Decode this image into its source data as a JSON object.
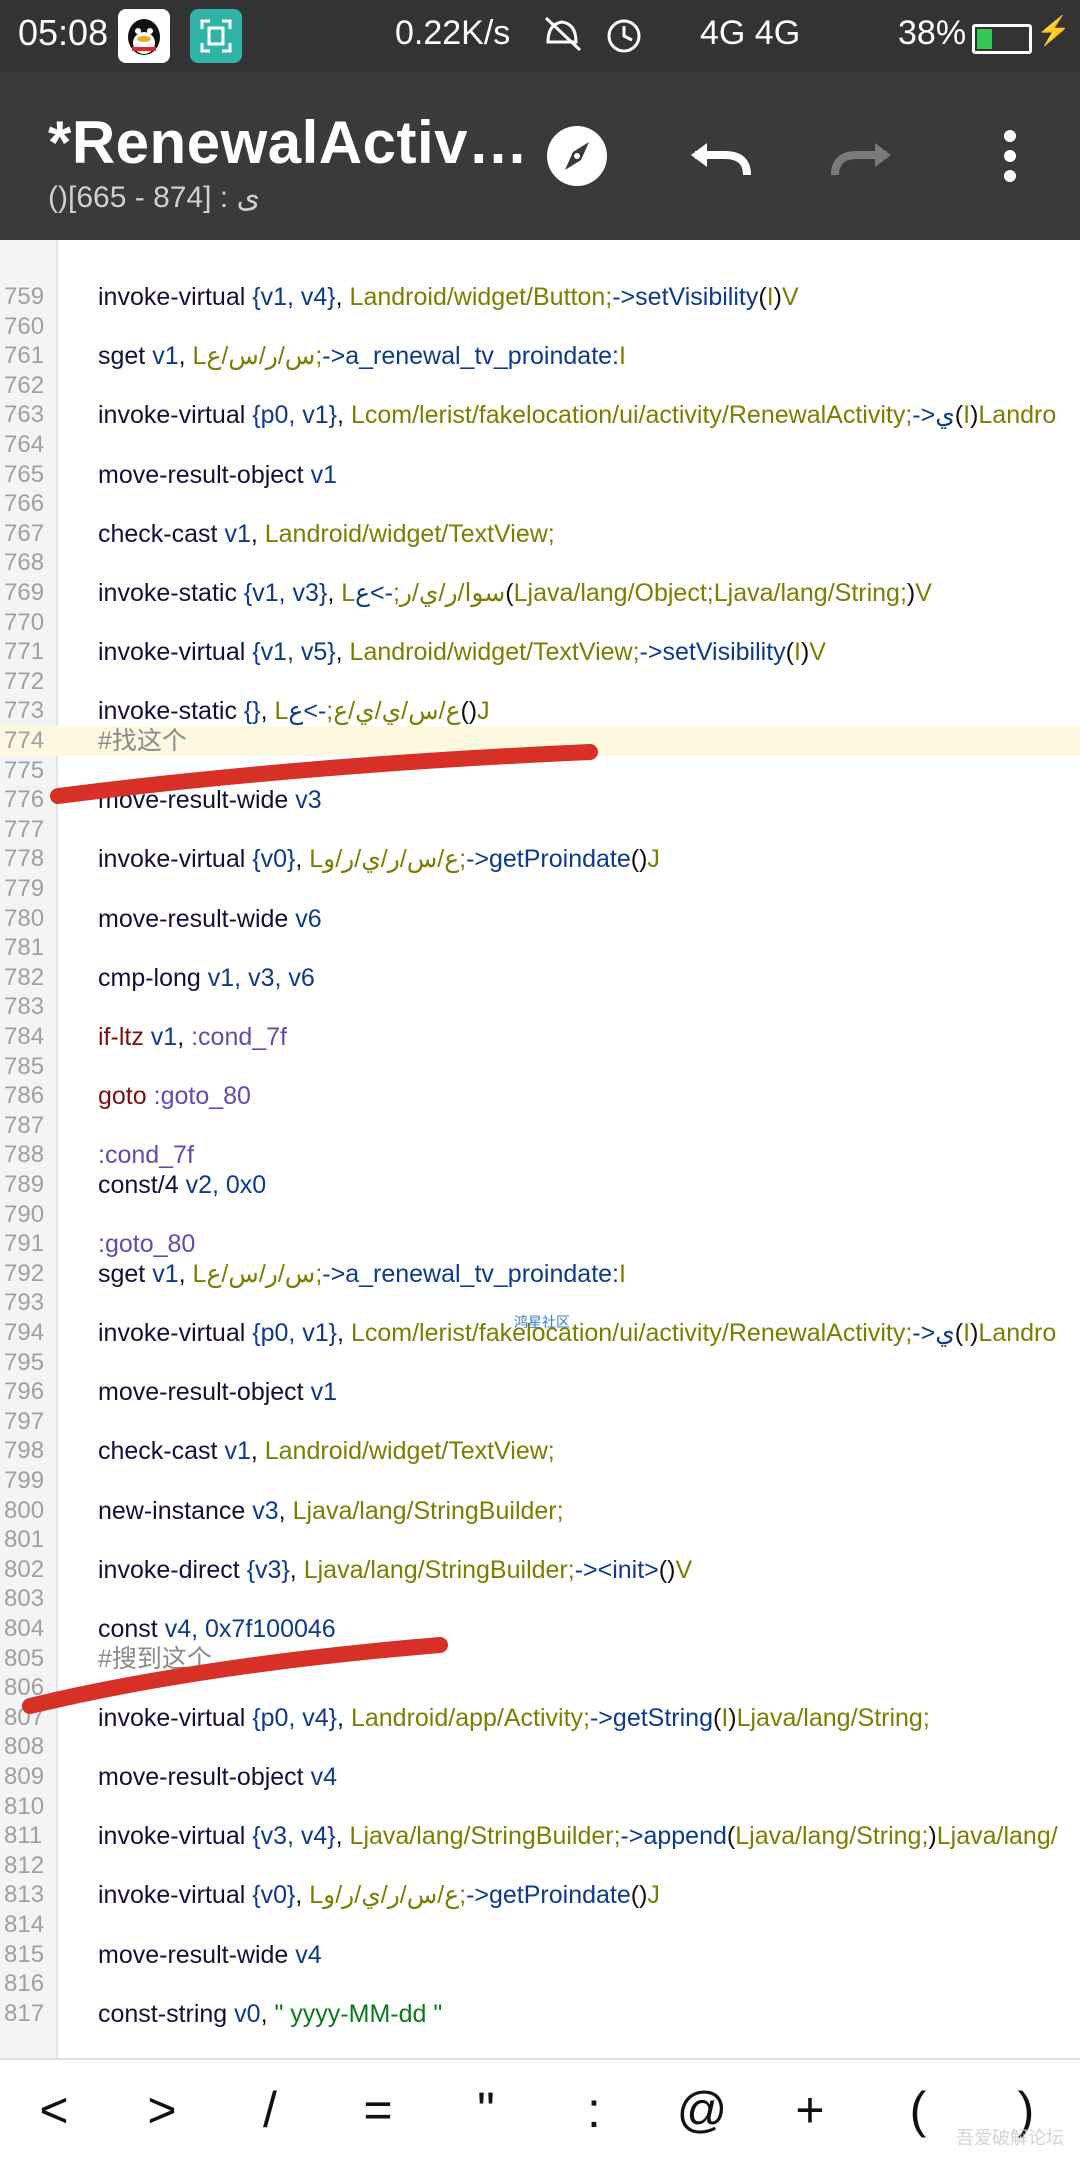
{
  "status_bar": {
    "time": "05:08",
    "speed": "0.22K/s",
    "network": "4G 4G",
    "battery": "38%",
    "battery_level_pct": 30
  },
  "toolbar": {
    "title": "*RenewalActiv…",
    "subtitle": "()ى : [874 - 665]"
  },
  "code": {
    "lines": [
      {
        "n": "759",
        "html": "<span class='kw'>invoke-virtual</span>  <span class='reg'>{v1,  v4}</span>,  <span class='type'>Landroid/widget/Button;</span><span class='meth'>-&gt;setVisibility</span>(<span class='type'>I</span>)<span class='type'>V</span>"
      },
      {
        "n": "760",
        "html": ""
      },
      {
        "n": "761",
        "html": "<span class='kw'>sget</span>  <span class='reg'>v1</span>,  <span class='type'>Lس/ر/س/ع;</span><span class='meth'>-&gt;a_renewal_tv_proindate:</span><span class='type'>I</span>"
      },
      {
        "n": "762",
        "html": ""
      },
      {
        "n": "763",
        "html": "<span class='kw'>invoke-virtual</span>  <span class='reg'>{p0,  v1}</span>,  <span class='type'>Lcom/lerist/fakelocation/ui/activity/RenewalActivity;</span><span class='meth'>-&gt;ي</span>(<span class='type'>I</span>)<span class='type'>Landro</span>"
      },
      {
        "n": "764",
        "html": ""
      },
      {
        "n": "765",
        "html": "<span class='kw'>move-result-object</span>  <span class='reg'>v1</span>"
      },
      {
        "n": "766",
        "html": ""
      },
      {
        "n": "767",
        "html": "<span class='kw'>check-cast</span>  <span class='reg'>v1</span>,  <span class='type'>Landroid/widget/TextView;</span>"
      },
      {
        "n": "768",
        "html": ""
      },
      {
        "n": "769",
        "html": "<span class='kw'>invoke-static</span>  <span class='reg'>{v1,  v3}</span>,  <span class='type'>Lسوا/ر/ي/ر;</span><span class='meth'>-&gt;ع</span>(<span class='type'>Ljava/lang/Object;Ljava/lang/String;</span>)<span class='type'>V</span>"
      },
      {
        "n": "770",
        "html": ""
      },
      {
        "n": "771",
        "html": "<span class='kw'>invoke-virtual</span>  <span class='reg'>{v1,  v5}</span>,  <span class='type'>Landroid/widget/TextView;</span><span class='meth'>-&gt;setVisibility</span>(<span class='type'>I</span>)<span class='type'>V</span>"
      },
      {
        "n": "772",
        "html": ""
      },
      {
        "n": "773",
        "html": "<span class='kw'>invoke-static</span>  <span class='reg'>{}</span>,  <span class='type'>Lع/س/ي/ي/ع;</span><span class='meth'>-&gt;ع</span>()<span class='type'>J</span>"
      },
      {
        "n": "774",
        "html": "<span class='cmt'>#找这个</span>",
        "hl": true
      },
      {
        "n": "775",
        "html": ""
      },
      {
        "n": "776",
        "html": "<span class='kw'>move-result-wide</span>  <span class='reg'>v3</span>"
      },
      {
        "n": "777",
        "html": ""
      },
      {
        "n": "778",
        "html": "<span class='kw'>invoke-virtual</span>  <span class='reg'>{v0}</span>,  <span class='type'>Lع/س/ر/ي/ر/و;</span><span class='meth'>-&gt;getProindate</span>()<span class='type'>J</span>"
      },
      {
        "n": "779",
        "html": ""
      },
      {
        "n": "780",
        "html": "<span class='kw'>move-result-wide</span>  <span class='reg'>v6</span>"
      },
      {
        "n": "781",
        "html": ""
      },
      {
        "n": "782",
        "html": "<span class='kw'>cmp-long</span>  <span class='reg'>v1,  v3,  v6</span>"
      },
      {
        "n": "783",
        "html": ""
      },
      {
        "n": "784",
        "html": "<span class='jmp'>if-ltz</span>  <span class='reg'>v1</span>,  <span class='label'>:cond_7f</span>"
      },
      {
        "n": "785",
        "html": ""
      },
      {
        "n": "786",
        "html": "<span class='jmp'>goto</span>  <span class='label'>:goto_80</span>"
      },
      {
        "n": "787",
        "html": ""
      },
      {
        "n": "788",
        "html": "<span class='label'>:cond_7f</span>"
      },
      {
        "n": "789",
        "html": "<span class='kw'>const/4</span>  <span class='reg'>v2,  0x0</span>"
      },
      {
        "n": "790",
        "html": ""
      },
      {
        "n": "791",
        "html": "<span class='label'>:goto_80</span>"
      },
      {
        "n": "792",
        "html": "<span class='kw'>sget</span>  <span class='reg'>v1</span>,  <span class='type'>Lس/ر/س/ع;</span><span class='meth'>-&gt;a_renewal_tv_proindate:</span><span class='type'>I</span>"
      },
      {
        "n": "793",
        "html": ""
      },
      {
        "n": "794",
        "html": "<span class='kw'>invoke-virtual</span>  <span class='reg'>{p0,  v1}</span>,  <span class='type'>Lcom/lerist/fakelocation/ui/activity/RenewalActivity;</span><span class='meth'>-&gt;ي</span>(<span class='type'>I</span>)<span class='type'>Landro</span>"
      },
      {
        "n": "795",
        "html": ""
      },
      {
        "n": "796",
        "html": "<span class='kw'>move-result-object</span>  <span class='reg'>v1</span>"
      },
      {
        "n": "797",
        "html": ""
      },
      {
        "n": "798",
        "html": "<span class='kw'>check-cast</span>  <span class='reg'>v1</span>,  <span class='type'>Landroid/widget/TextView;</span>"
      },
      {
        "n": "799",
        "html": ""
      },
      {
        "n": "800",
        "html": "<span class='kw'>new-instance</span>  <span class='reg'>v3</span>,  <span class='type'>Ljava/lang/StringBuilder;</span>"
      },
      {
        "n": "801",
        "html": ""
      },
      {
        "n": "802",
        "html": "<span class='kw'>invoke-direct</span>  <span class='reg'>{v3}</span>,  <span class='type'>Ljava/lang/StringBuilder;</span><span class='meth'>-&gt;&lt;init&gt;</span>()<span class='type'>V</span>"
      },
      {
        "n": "803",
        "html": ""
      },
      {
        "n": "804",
        "html": "<span class='kw'>const</span>  <span class='reg'>v4,  0x7f100046</span>"
      },
      {
        "n": "805",
        "html": "<span class='cmt'>#搜到这个</span>"
      },
      {
        "n": "806",
        "html": ""
      },
      {
        "n": "807",
        "html": "<span class='kw'>invoke-virtual</span>  <span class='reg'>{p0,  v4}</span>,  <span class='type'>Landroid/app/Activity;</span><span class='meth'>-&gt;getString</span>(<span class='type'>I</span>)<span class='type'>Ljava/lang/String;</span>"
      },
      {
        "n": "808",
        "html": ""
      },
      {
        "n": "809",
        "html": "<span class='kw'>move-result-object</span>  <span class='reg'>v4</span>"
      },
      {
        "n": "810",
        "html": ""
      },
      {
        "n": "811",
        "html": "<span class='kw'>invoke-virtual</span>  <span class='reg'>{v3,  v4}</span>,  <span class='type'>Ljava/lang/StringBuilder;</span><span class='meth'>-&gt;append</span>(<span class='type'>Ljava/lang/String;</span>)<span class='type'>Ljava/lang/</span>"
      },
      {
        "n": "812",
        "html": ""
      },
      {
        "n": "813",
        "html": "<span class='kw'>invoke-virtual</span>  <span class='reg'>{v0}</span>,  <span class='type'>Lع/س/ر/ي/ر/و;</span><span class='meth'>-&gt;getProindate</span>()<span class='type'>J</span>"
      },
      {
        "n": "814",
        "html": ""
      },
      {
        "n": "815",
        "html": "<span class='kw'>move-result-wide</span>  <span class='reg'>v4</span>"
      },
      {
        "n": "816",
        "html": ""
      },
      {
        "n": "817",
        "html": "<span class='kw'>const-string</span>  <span class='reg'>v0</span>,  <span class='str'>\"    yyyy-MM-dd  \"</span>"
      }
    ]
  },
  "watermark": "鸿星社区",
  "symbol_bar": [
    "<",
    ">",
    "/",
    "=",
    "\"",
    ":",
    "@",
    "+",
    "(",
    ")"
  ],
  "brand_mark": "吾爱破解论坛",
  "colors": {
    "toolbar_bg": "#3a3a3a",
    "status_bg": "#333333",
    "annotation_red": "#d63027",
    "highlight_line": "#fff8e0"
  }
}
